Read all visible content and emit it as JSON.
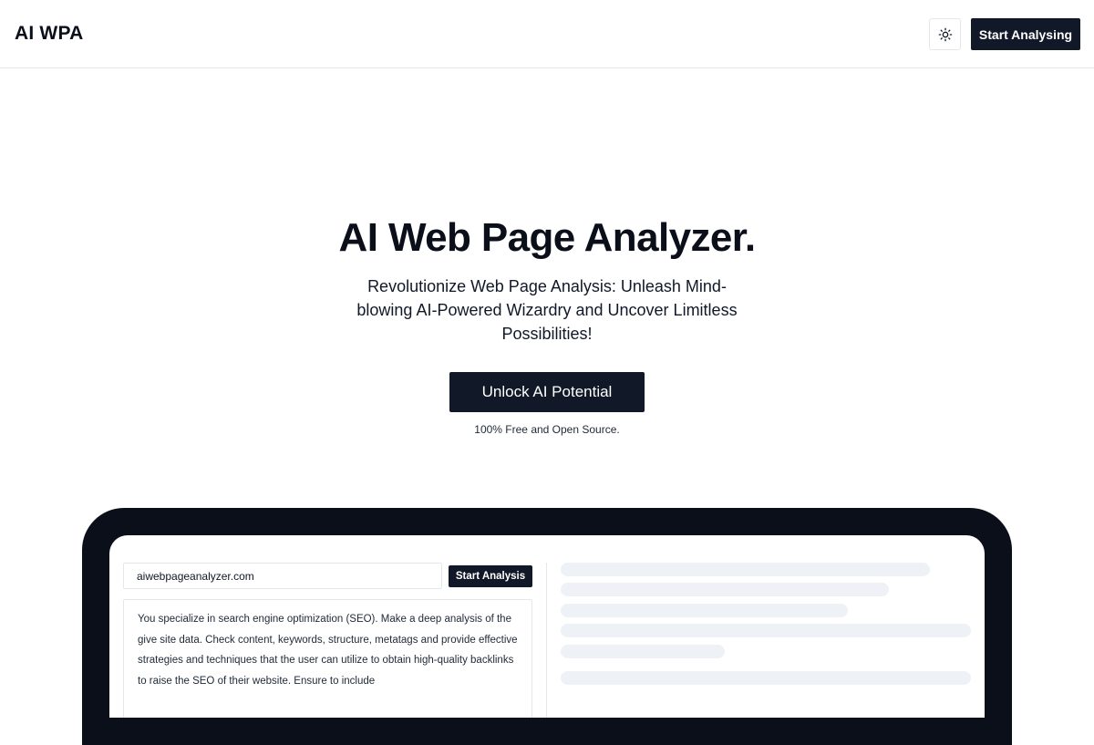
{
  "header": {
    "brand": "AI WPA",
    "theme_toggle_icon": "sun-icon",
    "cta_label": "Start Analysing"
  },
  "hero": {
    "title": "AI Web Page Analyzer.",
    "subtitle": "Revolutionize Web Page Analysis: Unleash Mind-blowing AI-Powered Wizardry and Uncover Limitless Possibilities!",
    "cta_label": "Unlock AI Potential",
    "note": "100% Free and Open Source."
  },
  "preview": {
    "url_value": "aiwebpageanalyzer.com",
    "analysis_label": "Start Analysis",
    "prompt_text": "You specialize in search engine optimization (SEO). Make a deep analysis of the give site data. Check content, keywords, structure, metatags and provide effective strategies and techniques that the user can utilize to obtain high-quality backlinks to raise the SEO of their website. Ensure to include"
  },
  "colors": {
    "primary": "#111827",
    "device_frame": "#0b0f19",
    "skeleton": "#eef2f7",
    "border": "#e5e7eb"
  }
}
